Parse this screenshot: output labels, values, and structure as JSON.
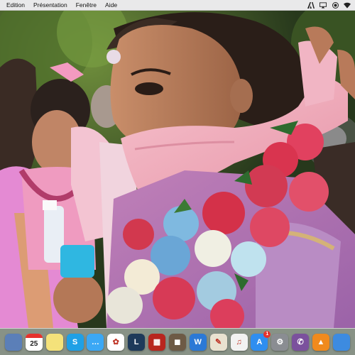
{
  "menubar": {
    "apple_icon": "apple-icon",
    "items": [
      "Edition",
      "Présentation",
      "Fenêtre",
      "Aide"
    ],
    "status_icons": [
      "adobe-icon",
      "screen-mirror-icon",
      "record-icon",
      "wifi-icon"
    ]
  },
  "viewer": {
    "content": "photo"
  },
  "dock": {
    "apps": [
      {
        "name": "preview-icon",
        "color": "#5b7fb8",
        "glyph": ""
      },
      {
        "name": "calendar-icon",
        "color": "#ffffff",
        "glyph": "25"
      },
      {
        "name": "notes-icon",
        "color": "#f4e27a",
        "glyph": ""
      },
      {
        "name": "skype-icon",
        "color": "#1fa0e6",
        "glyph": "S"
      },
      {
        "name": "messages-icon",
        "color": "#3ba8f5",
        "glyph": "…"
      },
      {
        "name": "photos-icon",
        "color": "#ffffff",
        "glyph": "✿"
      },
      {
        "name": "lightroom-icon",
        "color": "#1e3a5a",
        "glyph": "L"
      },
      {
        "name": "photo-booth-icon",
        "color": "#b8261e",
        "glyph": "▦"
      },
      {
        "name": "image-capture-icon",
        "color": "#6d5a45",
        "glyph": "◼"
      },
      {
        "name": "word-icon",
        "color": "#2b79d6",
        "glyph": "W"
      },
      {
        "name": "textedit-icon",
        "color": "#e9e2d0",
        "glyph": "✎"
      },
      {
        "name": "itunes-icon",
        "color": "#f2f2f2",
        "glyph": "♫"
      },
      {
        "name": "app-store-icon",
        "color": "#2f8ef0",
        "glyph": "A",
        "badge": "1"
      },
      {
        "name": "system-preferences-icon",
        "color": "#8a8d92",
        "glyph": "⚙"
      },
      {
        "name": "viber-icon",
        "color": "#7b519d",
        "glyph": "✆"
      },
      {
        "name": "vlc-icon",
        "color": "#f08a1d",
        "glyph": "▲"
      },
      {
        "name": "finder-icon",
        "color": "#3d8be0",
        "glyph": ""
      }
    ]
  }
}
